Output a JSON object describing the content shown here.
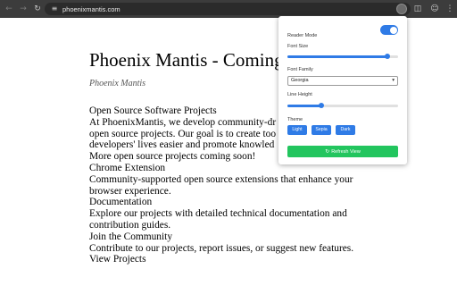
{
  "browser": {
    "url": "phoenixmantis.com",
    "icons": [
      "back-icon",
      "forward-icon",
      "reload-icon",
      "site-info-icon",
      "bookmark-star-icon",
      "extension-icon",
      "side-panel-icon",
      "profile-icon",
      "menu-icon"
    ]
  },
  "page": {
    "title": "Phoenix Mantis - Coming",
    "author": "Phoenix Mantis",
    "lines": [
      "Open Source Software Projects",
      "At PhoenixMantis, we develop community-dr",
      "open source projects. Our goal is to create too",
      "developers' lives easier and promote knowled",
      "More open source projects coming soon!",
      "Chrome Extension",
      "Community-supported open source extensions that enhance your",
      "browser experience.",
      "Documentation",
      "Explore our projects with detailed technical documentation and",
      "contribution guides.",
      "Join the Community",
      "Contribute to our projects, report issues, or suggest new features.",
      "View Projects"
    ]
  },
  "popup": {
    "reader_mode_label": "Reader Mode",
    "reader_mode_on": true,
    "font_size_label": "Font Size",
    "font_size_level": 0.9,
    "font_family_label": "Font Family",
    "font_family_value": "Georgia",
    "line_height_label": "Line Height",
    "line_height_level": 0.31,
    "theme_label": "Theme",
    "theme_buttons": [
      "Light",
      "Sepia",
      "Dark"
    ],
    "refresh_label": "Refresh View",
    "accent_color": "#2f7be6",
    "refresh_color": "#22c55e"
  }
}
